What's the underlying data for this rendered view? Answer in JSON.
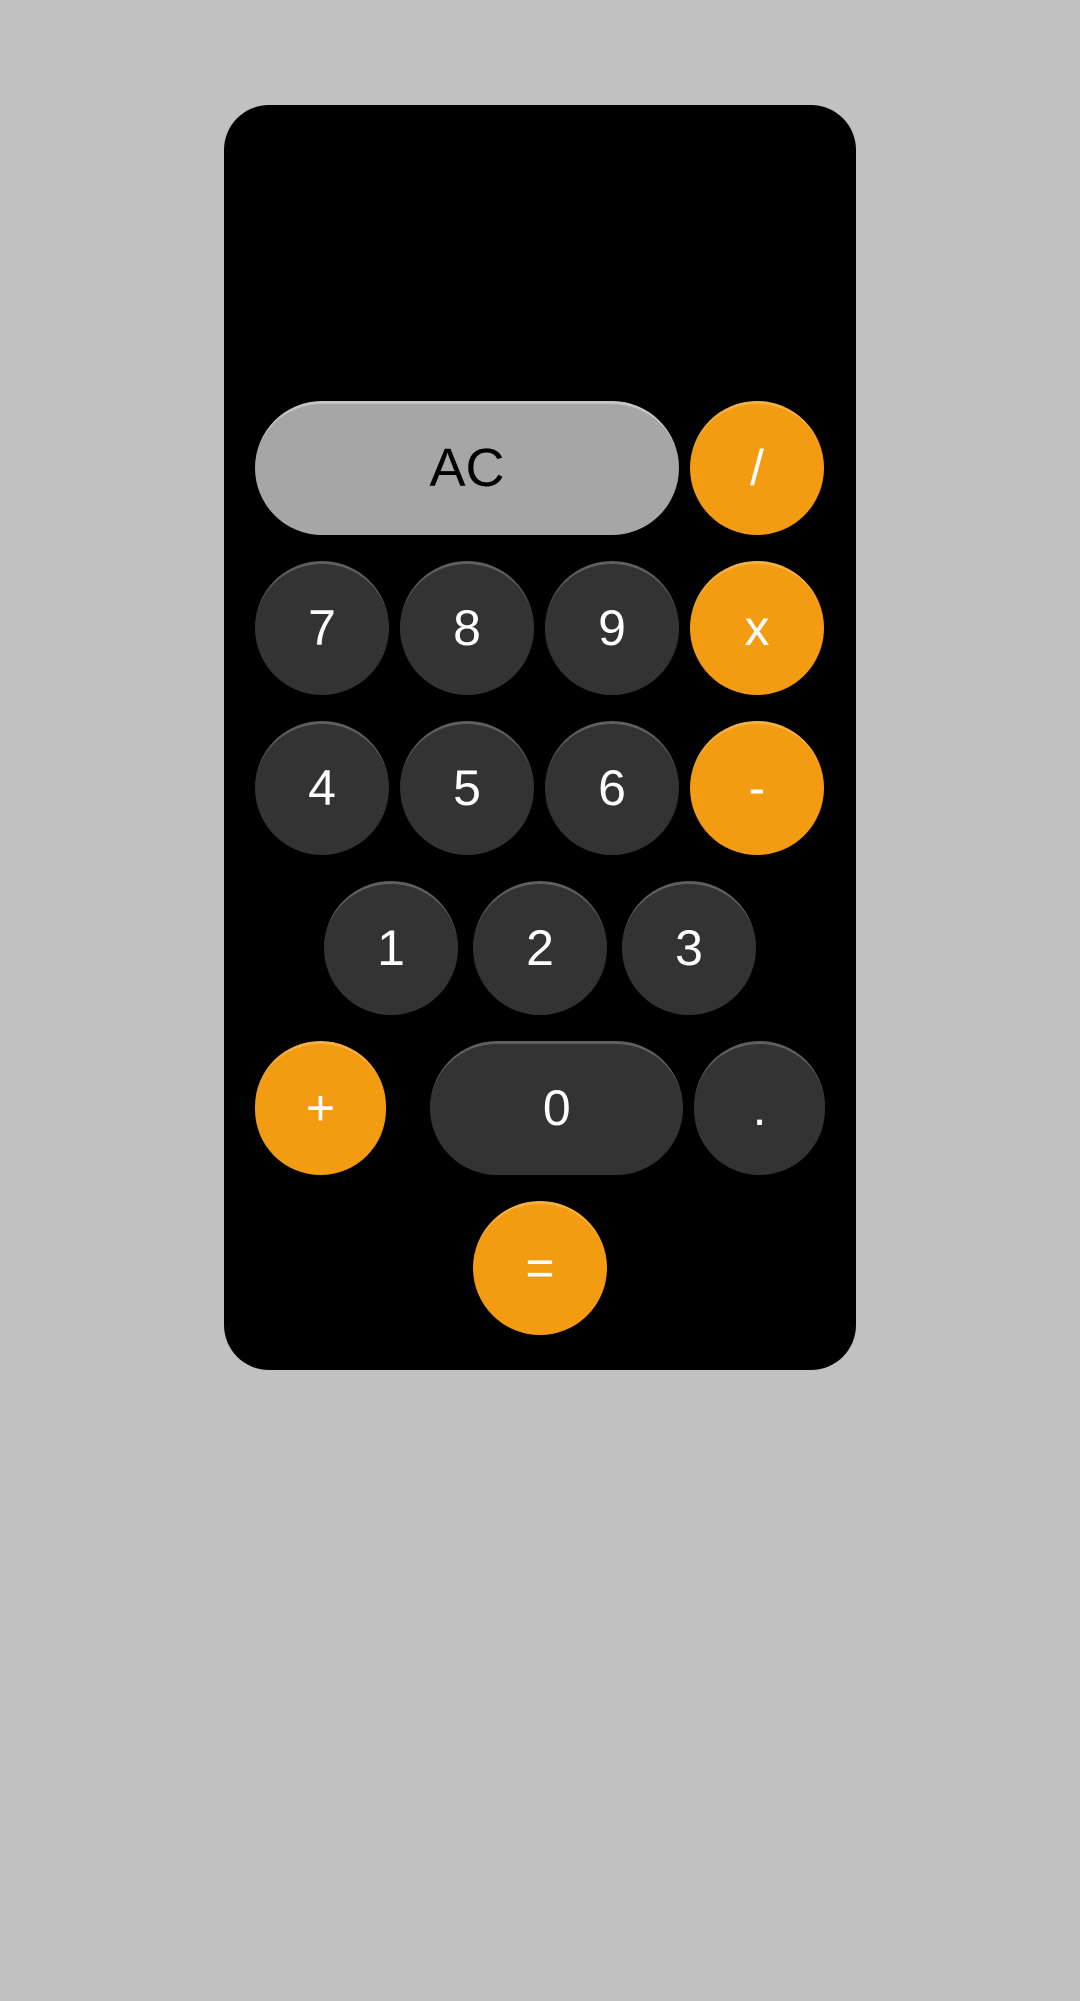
{
  "calculator": {
    "display": "",
    "keys": {
      "clear": "AC",
      "divide": "/",
      "multiply": "x",
      "subtract": "-",
      "add": "+",
      "equals": "=",
      "decimal": ".",
      "n0": "0",
      "n1": "1",
      "n2": "2",
      "n3": "3",
      "n4": "4",
      "n5": "5",
      "n6": "6",
      "n7": "7",
      "n8": "8",
      "n9": "9"
    },
    "colors": {
      "operator": "#f39c12",
      "number": "#333333",
      "function": "#a6a6a6",
      "background": "#000000",
      "page_bg": "#c1c1c1"
    }
  }
}
